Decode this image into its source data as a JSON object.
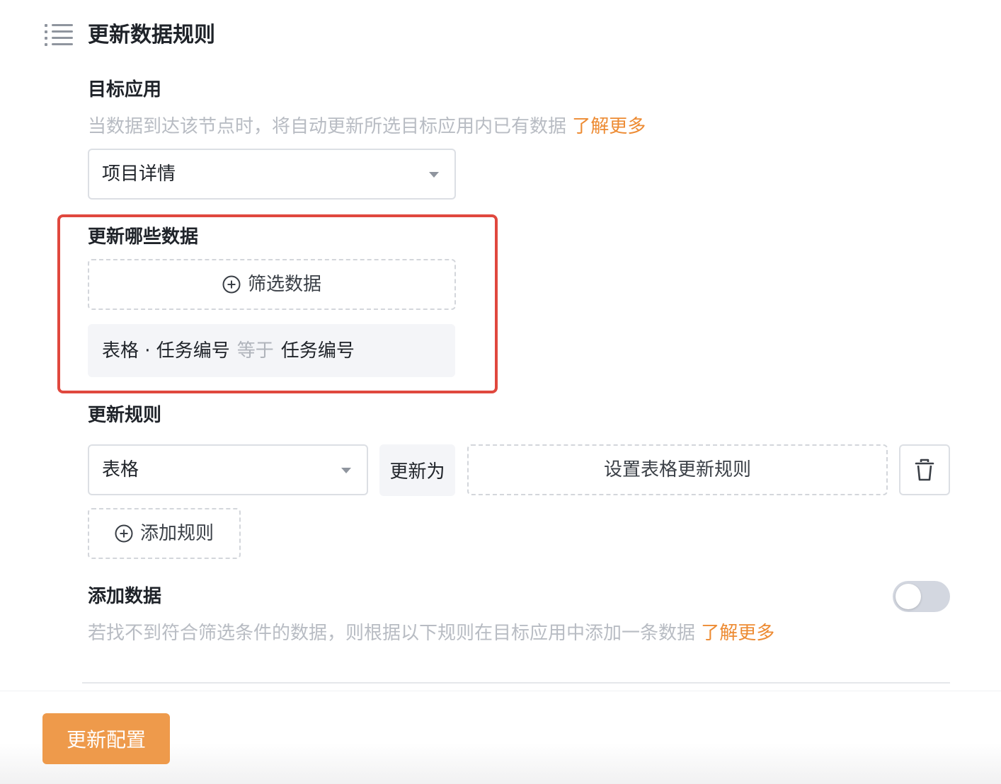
{
  "header": {
    "icon": "list-icon",
    "title": "更新数据规则"
  },
  "target_app": {
    "label": "目标应用",
    "hint": "当数据到达该节点时，将自动更新所选目标应用内已有数据",
    "learn_more": "了解更多",
    "selected_app": "项目详情"
  },
  "which_data": {
    "label": "更新哪些数据",
    "filter_button": "筛选数据",
    "condition": {
      "field": "表格 · 任务编号",
      "operator": "等于",
      "value": "任务编号"
    }
  },
  "update_rules": {
    "label": "更新规则",
    "field_select": "表格",
    "update_to": "更新为",
    "set_rule_button": "设置表格更新规则",
    "add_rule_button": "添加规则"
  },
  "add_data": {
    "label": "添加数据",
    "hint": "若找不到符合筛选条件的数据，则根据以下规则在目标应用中添加一条数据",
    "learn_more": "了解更多",
    "toggle_on": false
  },
  "footer": {
    "primary_button": "更新配置"
  },
  "colors": {
    "accent": "#ed8b33",
    "primary_button": "#ee9a4b",
    "highlight": "#e0483e"
  }
}
